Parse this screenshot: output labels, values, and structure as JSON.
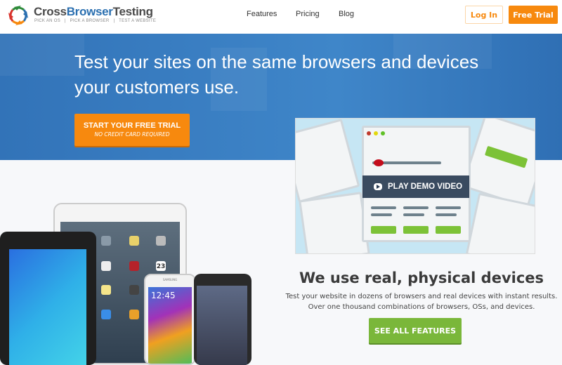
{
  "header": {
    "brand_part1": "Cross",
    "brand_part2": "Browser",
    "brand_part3": "Testing",
    "tagline": "PICK AN OS   |   PICK A BROWSER   |   TEST A WEBSITE",
    "nav": [
      {
        "label": "Features"
      },
      {
        "label": "Pricing"
      },
      {
        "label": "Blog"
      }
    ],
    "login_label": "Log In",
    "trial_label": "Free Trial"
  },
  "hero": {
    "headline_line1": "Test your sites on the same browsers and devices",
    "headline_line2": "your customers use.",
    "cta_label": "START YOUR FREE TRIAL",
    "cta_sub": "NO CREDIT CARD REQUIRED"
  },
  "video": {
    "play_label": "PLAY DEMO VIDEO"
  },
  "devices": {
    "phone_time": "12:45",
    "calendar_day": "23",
    "phone_brand": "SAMSUNG"
  },
  "features": {
    "title": "We use real, physical devices",
    "desc_line1": "Test your website in dozens of browsers and real devices with instant results.",
    "desc_line2": "Over one thousand combinations of browsers, OSs, and devices.",
    "button_label": "SEE ALL FEATURES"
  },
  "colors": {
    "orange": "#f7890e",
    "blue": "#3273b8",
    "green": "#7ab73a"
  }
}
